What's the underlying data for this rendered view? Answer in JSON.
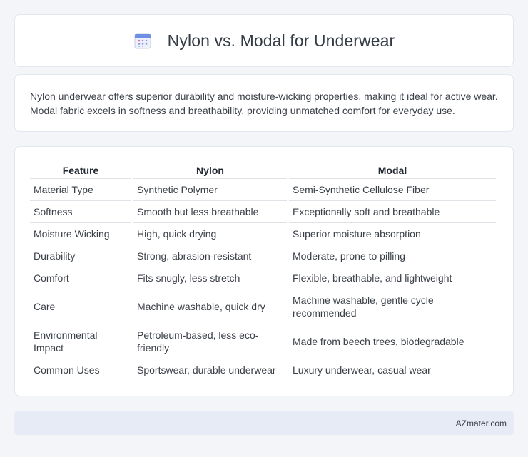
{
  "header": {
    "title": "Nylon vs. Modal for Underwear",
    "icon": "calendar-icon"
  },
  "intro": {
    "text": "Nylon underwear offers superior durability and moisture-wicking properties, making it ideal for active wear. Modal fabric excels in softness and breathability, providing unmatched comfort for everyday use."
  },
  "table": {
    "headers": [
      "Feature",
      "Nylon",
      "Modal"
    ],
    "rows": [
      [
        "Material Type",
        "Synthetic Polymer",
        "Semi-Synthetic Cellulose Fiber"
      ],
      [
        "Softness",
        "Smooth but less breathable",
        "Exceptionally soft and breathable"
      ],
      [
        "Moisture Wicking",
        "High, quick drying",
        "Superior moisture absorption"
      ],
      [
        "Durability",
        "Strong, abrasion-resistant",
        "Moderate, prone to pilling"
      ],
      [
        "Comfort",
        "Fits snugly, less stretch",
        "Flexible, breathable, and lightweight"
      ],
      [
        "Care",
        "Machine washable, quick dry",
        "Machine washable, gentle cycle recommended"
      ],
      [
        "Environmental Impact",
        "Petroleum-based, less eco-friendly",
        "Made from beech trees, biodegradable"
      ],
      [
        "Common Uses",
        "Sportswear, durable underwear",
        "Luxury underwear, casual wear"
      ]
    ]
  },
  "footer": {
    "text": "AZmater.com"
  },
  "colors": {
    "background": "#f3f5f9",
    "card": "#ffffff",
    "footer": "#e6ebf5",
    "icon_accent": "#5b7be0"
  }
}
